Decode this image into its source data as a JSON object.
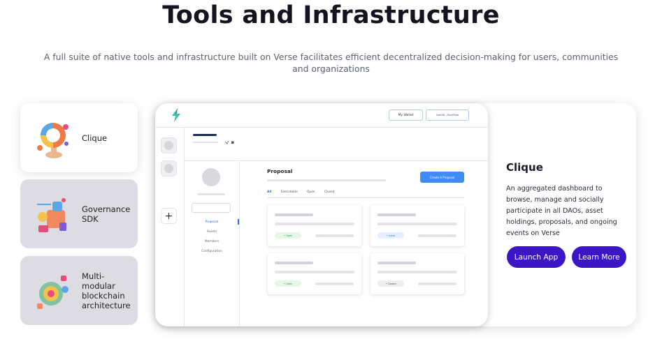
{
  "header": {
    "title": "Tools and Infrastructure",
    "subtitle": "A full suite of native tools and infrastructure built on Verse facilitates efficient decentralized decision-making for users, communities and organizations"
  },
  "tabs": [
    {
      "label": "Clique",
      "active": true,
      "icon": "clique-illustration-icon"
    },
    {
      "label": "Governance SDK",
      "active": false,
      "icon": "governance-sdk-illustration-icon"
    },
    {
      "label": "Multi-modular blockchain architecture",
      "active": false,
      "icon": "blockchain-architecture-illustration-icon"
    }
  ],
  "mockup": {
    "wallet_button": "My Wallet",
    "address": "0xef48...f0ce95bd",
    "add_symbol": "+",
    "menu": [
      "Proposal",
      "Assets",
      "Members",
      "Configuration"
    ],
    "section_title": "Proposal",
    "create_button": "Create A Proposal",
    "filters": [
      "All",
      "Executable",
      "Open",
      "Closed"
    ],
    "statuses": [
      "• Open",
      "• Local",
      "• Open",
      "• Closed"
    ]
  },
  "detail": {
    "title": "Clique",
    "description": "An aggregated dashboard to browse, manage and socially participate in all DAOs, asset holdings, proposals, and ongoing events on Verse",
    "primary_button": "Launch App",
    "secondary_button": "Learn More"
  },
  "colors": {
    "accent": "#3c15c7",
    "create_button": "#3f8cf4",
    "inactive_tab": "#dcdce2"
  }
}
